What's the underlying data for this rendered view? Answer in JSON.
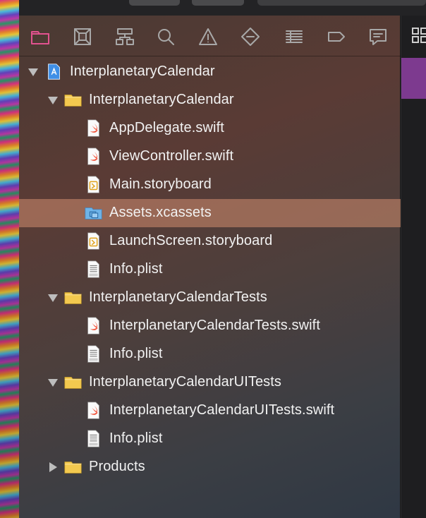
{
  "navigator_tabs": [
    {
      "name": "project-navigator",
      "icon": "folder-icon",
      "active": true
    },
    {
      "name": "source-control",
      "icon": "source-control-icon"
    },
    {
      "name": "symbol-navigator",
      "icon": "hierarchy-icon"
    },
    {
      "name": "find-navigator",
      "icon": "search-icon"
    },
    {
      "name": "issue-navigator",
      "icon": "warning-icon"
    },
    {
      "name": "test-navigator",
      "icon": "diamond-icon"
    },
    {
      "name": "debug-navigator",
      "icon": "list-icon"
    },
    {
      "name": "breakpoint-navigator",
      "icon": "breakpoint-icon"
    },
    {
      "name": "report-navigator",
      "icon": "message-icon"
    }
  ],
  "tree": [
    {
      "label": "InterplanetaryCalendar",
      "kind": "project",
      "indent": 0,
      "disclosure": "open"
    },
    {
      "label": "InterplanetaryCalendar",
      "kind": "folder",
      "indent": 1,
      "disclosure": "open"
    },
    {
      "label": "AppDelegate.swift",
      "kind": "swift",
      "indent": 2
    },
    {
      "label": "ViewController.swift",
      "kind": "swift",
      "indent": 2
    },
    {
      "label": "Main.storyboard",
      "kind": "storyboard",
      "indent": 2
    },
    {
      "label": "Assets.xcassets",
      "kind": "xcassets",
      "indent": 2,
      "selected": true
    },
    {
      "label": "LaunchScreen.storyboard",
      "kind": "storyboard",
      "indent": 2
    },
    {
      "label": "Info.plist",
      "kind": "plist",
      "indent": 2
    },
    {
      "label": "InterplanetaryCalendarTests",
      "kind": "folder",
      "indent": 1,
      "disclosure": "open"
    },
    {
      "label": "InterplanetaryCalendarTests.swift",
      "kind": "swift",
      "indent": 2
    },
    {
      "label": "Info.plist",
      "kind": "plist",
      "indent": 2
    },
    {
      "label": "InterplanetaryCalendarUITests",
      "kind": "folder",
      "indent": 1,
      "disclosure": "open"
    },
    {
      "label": "InterplanetaryCalendarUITests.swift",
      "kind": "swift",
      "indent": 2
    },
    {
      "label": "Info.plist",
      "kind": "plist",
      "indent": 2
    },
    {
      "label": "Products",
      "kind": "folder",
      "indent": 1,
      "disclosure": "closed"
    }
  ],
  "colors": {
    "active_tab": "#e2528f",
    "inactive_tab": "#a8a8a8",
    "folder": "#f3c94f",
    "swift": "#f05138",
    "xcassets": "#6fb4e8"
  }
}
